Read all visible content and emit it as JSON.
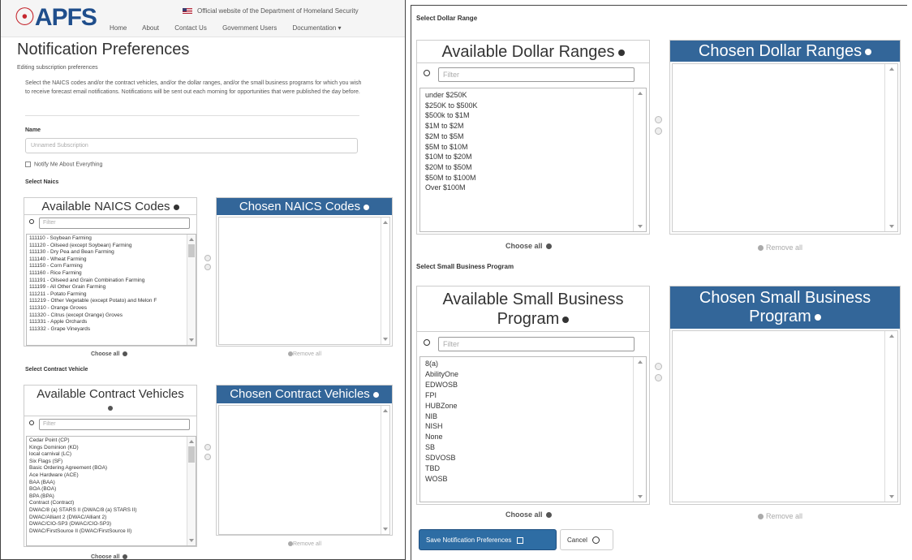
{
  "nav": {
    "logo": "APFS",
    "official_notice": "Official website of the Department of Homeland Security",
    "links": [
      "Home",
      "About",
      "Contact Us",
      "Government Users",
      "Documentation ▾"
    ]
  },
  "page": {
    "title": "Notification Preferences",
    "subtitle": "Editing subscription preferences",
    "intro": "Select the NAICS codes and/or the contract vehicles, and/or the dollar ranges, and/or the small business programs for which you wish to receive forecast email notifications. Notifications will be sent out each morning for opportunities that were published the day before.",
    "name_label": "Name",
    "name_placeholder": "Unnamed Subscription",
    "notify_label": "Notify Me About Everything"
  },
  "naics": {
    "section_label": "Select Naics",
    "available_title": "Available NAICS Codes",
    "chosen_title": "Chosen NAICS Codes",
    "filter_placeholder": "Filter",
    "items": [
      "111110 - Soybean Farming",
      "111120 - Oilseed (except Soybean) Farming",
      "111130 - Dry Pea and Bean Farming",
      "111140 - Wheat Farming",
      "111150 - Corn Farming",
      "111160 - Rice Farming",
      "111191 - Oilseed and Grain Combination Farming",
      "111199 - All Other Grain Farming",
      "111211 - Potato Farming",
      "111219 - Other Vegetable (except Potato) and Melon F",
      "111310 - Orange Groves",
      "111320 - Citrus (except Orange) Groves",
      "111331 - Apple Orchards",
      "111332 - Grape Vineyards"
    ],
    "choose_all": "Choose all",
    "remove_all": "Remove all"
  },
  "vehicles": {
    "section_label": "Select Contract Vehicle",
    "available_title": "Available Contract Vehicles",
    "chosen_title": "Chosen Contract Vehicles",
    "filter_placeholder": "Filter",
    "items": [
      "Cedar Point (CP)",
      "Kings Dominion (KD)",
      "local carnival (LC)",
      "Six Flags (SF)",
      "Basic Ordering Agreement (BOA)",
      "Ace Hardware (ACE)",
      "BAA (BAA)",
      "BOA (BOA)",
      "BPA (BPA)",
      "Contract (Contract)",
      "DWAC/8 (a) STARS II (DWAC/8 (a) STARS II)",
      "DWAC/Alliant 2 (DWAC/Alliant 2)",
      "DWAC/CIO-SP3 (DWAC/CIO-SP3)",
      "DWAC/FirstSource II (DWAC/FirstSource II)"
    ],
    "choose_all": "Choose all",
    "remove_all": "Remove all"
  },
  "dollar": {
    "section_label": "Select Dollar Range",
    "available_title": "Available Dollar Ranges",
    "chosen_title": "Chosen Dollar Ranges",
    "filter_placeholder": "Filter",
    "items": [
      "under $250K",
      "$250K to $500K",
      "$500k to $1M",
      "$1M to $2M",
      "$2M to $5M",
      "$5M to $10M",
      "$10M to $20M",
      "$20M to $50M",
      "$50M to $100M",
      "Over $100M"
    ],
    "choose_all": "Choose all",
    "remove_all": "Remove all"
  },
  "small_business": {
    "section_label": "Select Small Business Program",
    "available_title_line1": "Available Small Business",
    "available_title_line2": "Program",
    "chosen_title_line1": "Chosen Small Business",
    "chosen_title_line2": "Program",
    "filter_placeholder": "Filter",
    "items": [
      "8(a)",
      "AbilityOne",
      "EDWOSB",
      "FPI",
      "HUBZone",
      "NIB",
      "NISH",
      "None",
      "SB",
      "SDVOSB",
      "TBD",
      "WOSB"
    ],
    "choose_all": "Choose all",
    "remove_all": "Remove all"
  },
  "actions": {
    "save_label": "Save Notification Preferences",
    "cancel_label": "Cancel"
  },
  "colors": {
    "chosen_header_bg": "#336699",
    "primary_button": "#2e6da4",
    "logo_blue": "#1f4e8c",
    "logo_red": "#c5282f"
  }
}
